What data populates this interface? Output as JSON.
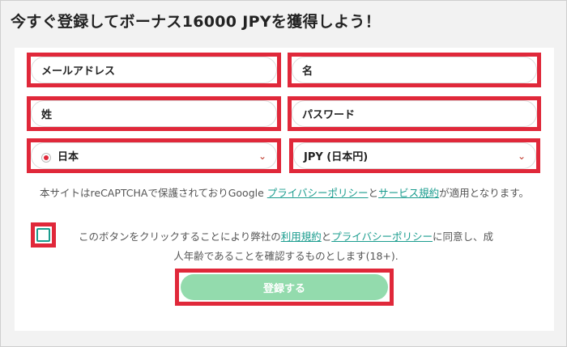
{
  "header": {
    "title": "今すぐ登録してボーナス16000 JPYを獲得しよう！"
  },
  "form": {
    "email_placeholder": "メールアドレス",
    "first_name_placeholder": "名",
    "last_name_placeholder": "姓",
    "password_placeholder": "パスワード",
    "country_value": "日本",
    "currency_value": "JPY (日本円)"
  },
  "recaptcha": {
    "text_before": "本サイトはreCAPTCHAで保護されておりGoogle ",
    "privacy_link": "プライバシーポリシー",
    "and": "と",
    "terms_link": "サービス規約",
    "text_after": "が適用となります。"
  },
  "consent": {
    "text_before": "このボタンをクリックすることにより弊社の",
    "terms_link": "利用規約",
    "and": "と",
    "privacy_link": "プライバシーポリシー",
    "text_after": "に同意し、成人年齢であることを確認するものとします(18+)."
  },
  "submit": {
    "label": "登録する"
  },
  "colors": {
    "highlight": "#e0283a",
    "accent": "#1a9c8e",
    "submit_bg": "#93dbad"
  },
  "icons": {
    "country_flag": "japan-flag-icon",
    "dropdown": "chevron-down-icon"
  }
}
